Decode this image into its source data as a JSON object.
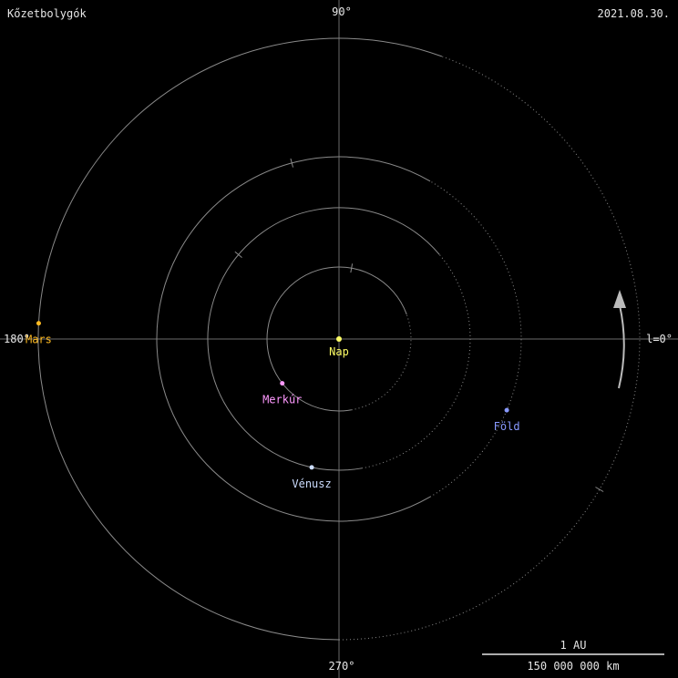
{
  "header": {
    "title": "Kőzetbolygók",
    "date": "2021.08.30."
  },
  "axes": {
    "top": "90°",
    "bottom": "270°",
    "left": "180°",
    "right": "l=0°"
  },
  "sun": {
    "name": "Nap",
    "color": "#ffff66"
  },
  "planets": [
    {
      "key": "mercury",
      "name": "Merkúr",
      "color": "#ff99ff",
      "longitude_deg": 218,
      "orbit_au": 0.387
    },
    {
      "key": "venus",
      "name": "Vénusz",
      "color": "#ccddff",
      "longitude_deg": 258,
      "orbit_au": 0.723
    },
    {
      "key": "earth",
      "name": "Föld",
      "color": "#8899ff",
      "longitude_deg": 337,
      "orbit_au": 1.0
    },
    {
      "key": "mars",
      "name": "Mars",
      "color": "#ffbb22",
      "longitude_deg": 177,
      "orbit_au": 1.524
    }
  ],
  "scale": {
    "label_top": "1 AU",
    "label_bottom": "150 000 000 km"
  },
  "colors": {
    "background": "#000000",
    "orbit": "#8a8a8a",
    "axis": "#6a6a6a",
    "text": "#e6e6e6",
    "arrow": "#bbbbbb"
  }
}
